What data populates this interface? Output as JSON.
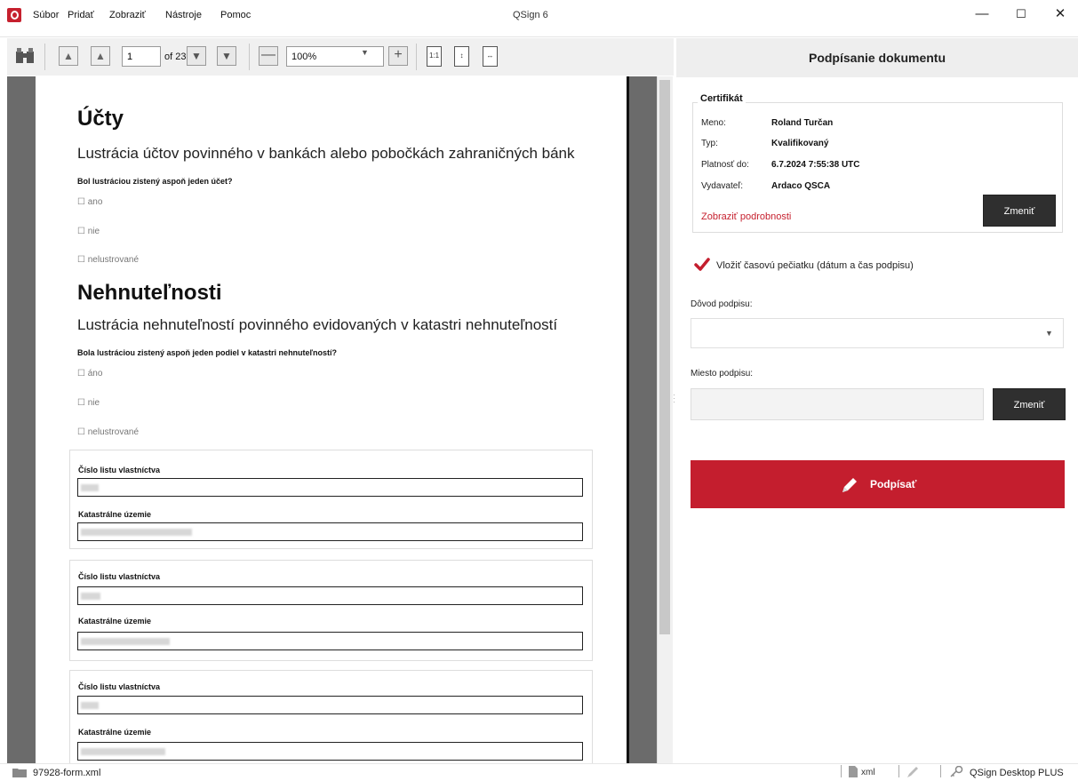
{
  "window": {
    "title": "QSign 6"
  },
  "menu": {
    "items": [
      "Súbor",
      "Pridať",
      "Zobraziť",
      "Nástroje",
      "Pomoc"
    ]
  },
  "toolbar": {
    "page": "1",
    "page_of": "of 23",
    "zoom": "100%",
    "actual_size_label": "1:1"
  },
  "document": {
    "section1_title": "Účty",
    "section1_subtitle": "Lustrácia účtov povinného v bankách alebo pobočkách zahraničných bánk",
    "section1_question": "Bol lustráciou zistený aspoň jeden účet?",
    "section1_options": [
      "☐ ano",
      "☐ nie",
      "☐ nelustrované"
    ],
    "section2_title": "Nehnuteľnosti",
    "section2_subtitle": "Lustrácia nehnuteľností povinného evidovaných v katastri nehnuteľností",
    "section2_question": "Bola lustráciou zistený aspoň jeden podiel v katastri nehnuteľností?",
    "section2_options": [
      "☐ áno",
      "☐ nie",
      "☐ nelustrované"
    ],
    "field_label_lv": "Číslo listu vlastníctva",
    "field_label_ku": "Katastrálne územie"
  },
  "panel": {
    "title": "Podpísanie dokumentu",
    "cert": {
      "legend": "Certifikát",
      "name_label": "Meno:",
      "name": "Roland Turčan",
      "type_label": "Typ:",
      "type": "Kvalifikovaný",
      "valid_label": "Platnosť do:",
      "valid": "6.7.2024 7:55:38 UTC",
      "issuer_label": "Vydavateľ:",
      "issuer": "Ardaco QSCA",
      "details_link": "Zobraziť podrobnosti",
      "change_button": "Zmeniť"
    },
    "timestamp_label": "Vložiť časovú pečiatku (dátum a čas podpisu)",
    "timestamp_checked": true,
    "reason_label": "Dôvod podpisu:",
    "reason_value": "",
    "place_label": "Miesto podpisu:",
    "place_value": "",
    "place_change_button": "Zmeniť",
    "sign_button": "Podpísať"
  },
  "status": {
    "file": "97928-form.xml",
    "format": "xml",
    "product": "QSign Desktop PLUS"
  },
  "colors": {
    "accent": "#c41e2e",
    "dark_button": "#2f2f2f"
  }
}
